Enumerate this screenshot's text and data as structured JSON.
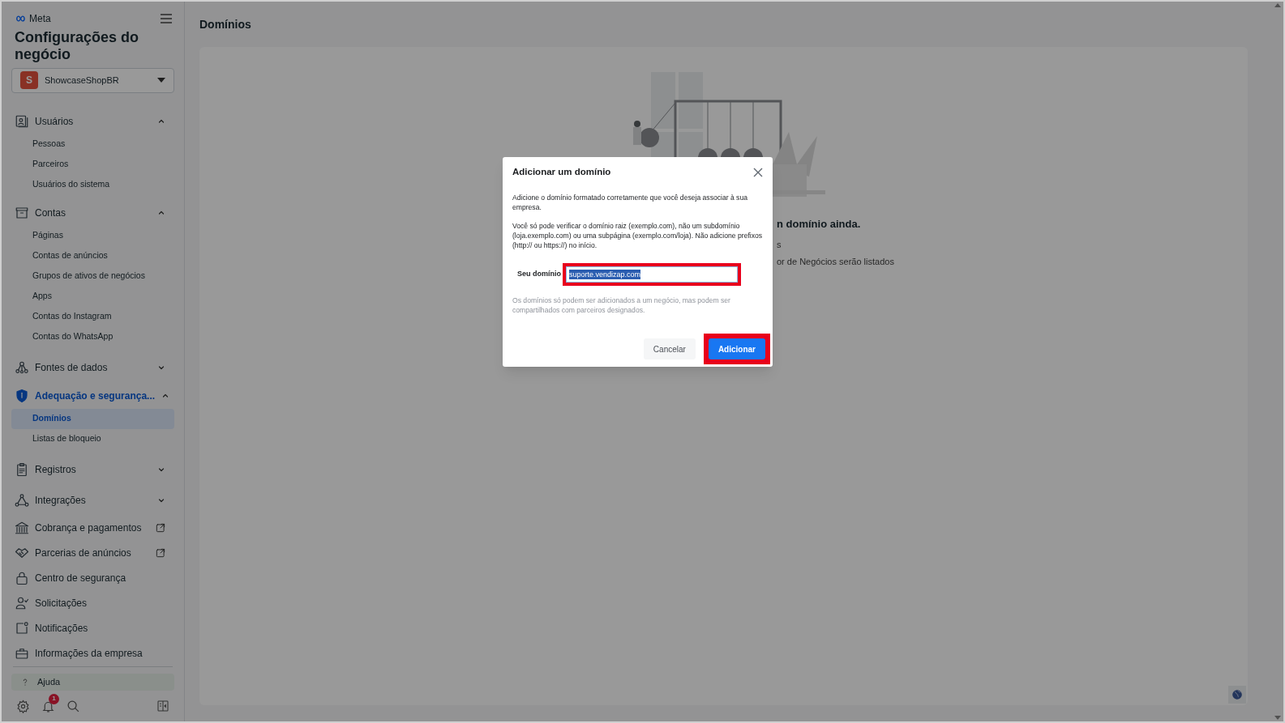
{
  "sidebar": {
    "brand": "Meta",
    "title": "Configurações do negócio",
    "account": {
      "initial": "S",
      "name": "ShowcaseShopBR"
    },
    "items": [
      {
        "kind": "group",
        "label": "Usuários",
        "expanded": true,
        "selected": false,
        "children": [
          {
            "label": "Pessoas",
            "selected": false
          },
          {
            "label": "Parceiros",
            "selected": false
          },
          {
            "label": "Usuários do sistema",
            "selected": false
          }
        ]
      },
      {
        "kind": "group",
        "label": "Contas",
        "expanded": true,
        "selected": false,
        "children": [
          {
            "label": "Páginas",
            "selected": false
          },
          {
            "label": "Contas de anúncios",
            "selected": false
          },
          {
            "label": "Grupos de ativos de negócios",
            "selected": false
          },
          {
            "label": "Apps",
            "selected": false
          },
          {
            "label": "Contas do Instagram",
            "selected": false
          },
          {
            "label": "Contas do WhatsApp",
            "selected": false
          }
        ]
      },
      {
        "kind": "group",
        "label": "Fontes de dados",
        "expanded": false,
        "selected": false
      },
      {
        "kind": "group",
        "label": "Adequação e segurança...",
        "expanded": true,
        "selected": true,
        "children": [
          {
            "label": "Domínios",
            "selected": true
          },
          {
            "label": "Listas de bloqueio",
            "selected": false
          }
        ]
      },
      {
        "kind": "group",
        "label": "Registros",
        "expanded": false,
        "selected": false
      },
      {
        "kind": "group",
        "label": "Integrações",
        "expanded": false,
        "selected": false
      },
      {
        "kind": "link",
        "label": "Cobrança e pagamentos",
        "external": true
      },
      {
        "kind": "link",
        "label": "Parcerias de anúncios",
        "external": true
      },
      {
        "kind": "link",
        "label": "Centro de segurança",
        "external": false
      },
      {
        "kind": "link",
        "label": "Solicitações",
        "external": false
      },
      {
        "kind": "link",
        "label": "Notificações",
        "external": false
      },
      {
        "kind": "link",
        "label": "Informações da empresa",
        "external": false
      }
    ],
    "help": "Ajuda",
    "notification_count": "1"
  },
  "main": {
    "title": "Domínios",
    "empty_state": [
      "n domínio ainda.",
      "s",
      "or de Negócios serão listados"
    ]
  },
  "dialog": {
    "title": "Adicionar um domínio",
    "paragraphs": [
      "Adicione o domínio formatado corretamente que você deseja associar à sua empresa.",
      "Você só pode verificar o domínio raiz (exemplo.com), não um subdomínio (loja.exemplo.com) ou uma subpágina (exemplo.com/loja). Não adicione prefixos (http:// ou https://) no início."
    ],
    "field": {
      "label": "Seu domínio",
      "value": "suporte.vendizap.com",
      "highlighted": true
    },
    "note": "Os domínios só podem ser adicionados a um negócio, mas podem ser compartilhados com parceiros designados.",
    "buttons": [
      {
        "label": "Cancelar",
        "kind": "secondary",
        "highlighted": false
      },
      {
        "label": "Adicionar",
        "kind": "primary",
        "highlighted": true
      }
    ]
  }
}
